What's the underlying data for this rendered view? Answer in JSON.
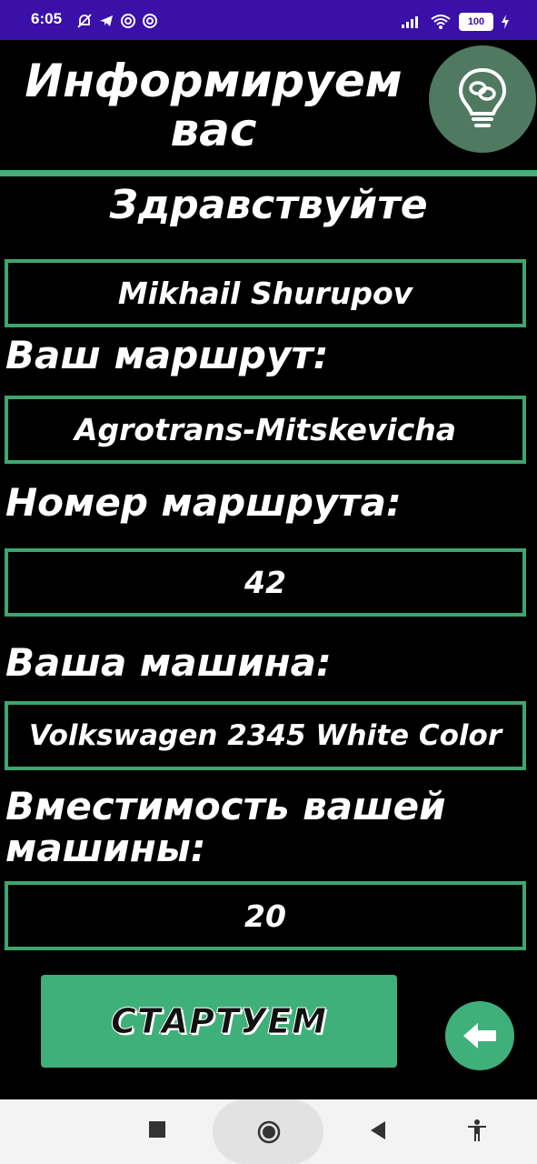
{
  "status_bar": {
    "time": "6:05",
    "battery": "100"
  },
  "header": {
    "title_line1": "Информируем",
    "title_line2": "вас"
  },
  "greeting": "Здравствуйте",
  "fields": {
    "name": "Mikhail Shurupov",
    "route_label": "Ваш маршрут:",
    "route": "Agrotrans-Mitskevicha",
    "route_number_label": "Номер маршрута:",
    "route_number": "42",
    "car_label": "Ваша машина:",
    "car": "Volkswagen 2345 White Color",
    "capacity_label_line1": "Вместимость вашей",
    "capacity_label_line2": "машины:",
    "capacity": "20"
  },
  "actions": {
    "start_label": "СТАРТУЕМ"
  },
  "colors": {
    "status_bar": "#3a10a8",
    "accent_green": "#3fb07a",
    "bulb_button": "#4f7a61",
    "background": "#000000"
  },
  "icons": [
    "bell-off-icon",
    "telegram-icon",
    "at-icon",
    "at-icon",
    "signal-icon",
    "wifi-icon",
    "battery-icon",
    "charging-icon",
    "lightbulb-icon",
    "arrow-left-icon",
    "nav-recents-icon",
    "nav-home-icon",
    "nav-back-icon",
    "accessibility-icon"
  ]
}
